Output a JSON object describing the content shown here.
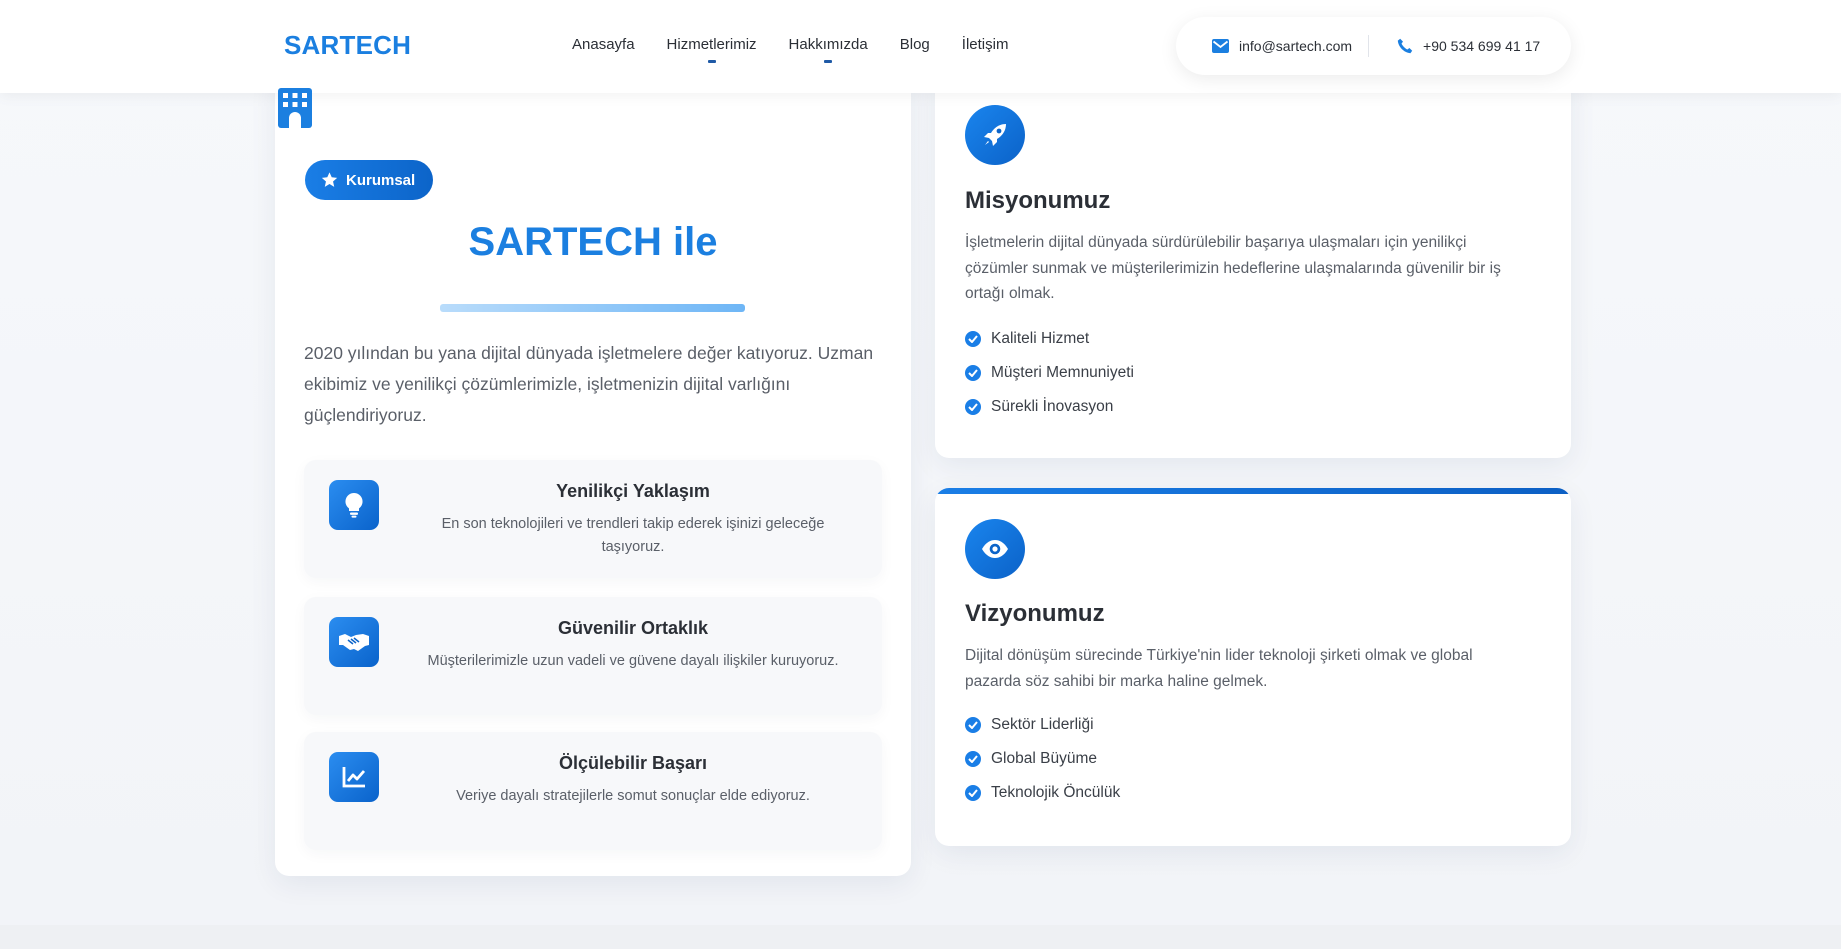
{
  "header": {
    "logo": "SARTECH",
    "nav": [
      {
        "label": "Anasayfa",
        "indicator": false
      },
      {
        "label": "Hizmetlerimiz",
        "indicator": true
      },
      {
        "label": "Hakkımızda",
        "indicator": true
      },
      {
        "label": "Blog",
        "indicator": false
      },
      {
        "label": "İletişim",
        "indicator": false
      }
    ],
    "email": "info@sartech.com",
    "phone": "+90 534 699 41 17"
  },
  "about": {
    "badge": "Kurumsal",
    "title": "SARTECH ile",
    "text": "2020 yılından bu yana dijital dünyada işletmelere değer katıyoruz. Uzman ekibimiz ve yenilikçi çözümlerimizle, işletmenizin dijital varlığını güçlendiriyoruz.",
    "features": [
      {
        "icon": "lightbulb-icon",
        "title": "Yenilikçi Yaklaşım",
        "desc": "En son teknolojileri ve trendleri takip ederek işinizi geleceğe taşıyoruz."
      },
      {
        "icon": "handshake-icon",
        "title": "Güvenilir Ortaklık",
        "desc": "Müşterilerimizle uzun vadeli ve güvene dayalı ilişkiler kuruyoruz."
      },
      {
        "icon": "chart-line-icon",
        "title": "Ölçülebilir Başarı",
        "desc": "Veriye dayalı stratejilerle somut sonuçlar elde ediyoruz."
      }
    ]
  },
  "mission": {
    "icon": "rocket-icon",
    "title": "Misyonumuz",
    "text": "İşletmelerin dijital dünyada sürdürülebilir başarıya ulaşmaları için yenilikçi çözümler sunmak ve müşterilerimizin hedeflerine ulaşmalarında güvenilir bir iş ortağı olmak.",
    "items": [
      "Kaliteli Hizmet",
      "Müşteri Memnuniyeti",
      "Sürekli İnovasyon"
    ]
  },
  "vision": {
    "icon": "eye-icon",
    "title": "Vizyonumuz",
    "text": "Dijital dönüşüm sürecinde Türkiye'nin lider teknoloji şirketi olmak ve global pazarda söz sahibi bir marka haline gelmek.",
    "items": [
      "Sektör Liderliği",
      "Global Büyüme",
      "Teknolojik Öncülük"
    ]
  },
  "colors": {
    "accent": "#1b7fe0",
    "accent_dark": "#0c64c9",
    "text": "#2b2f36",
    "muted": "#5a5f68"
  }
}
